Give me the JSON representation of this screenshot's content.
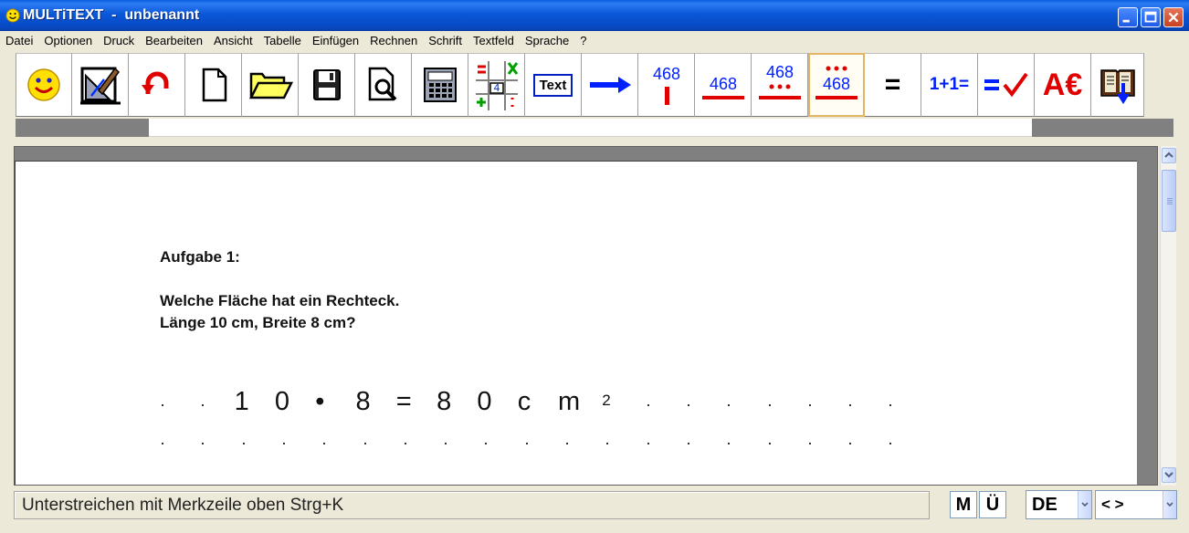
{
  "window": {
    "title": "MULTiTEXT  -  unbenannt"
  },
  "menu": {
    "items": [
      {
        "label": "Datei"
      },
      {
        "label": "Optionen"
      },
      {
        "label": "Druck"
      },
      {
        "label": "Bearbeiten"
      },
      {
        "label": "Ansicht"
      },
      {
        "label": "Tabelle"
      },
      {
        "label": "Einfügen"
      },
      {
        "label": "Rechnen"
      },
      {
        "label": "Schrift"
      },
      {
        "label": "Textfeld"
      },
      {
        "label": "Sprache"
      },
      {
        "label": "?"
      }
    ]
  },
  "toolbar": {
    "text_button_label": "Text",
    "num_label": "468",
    "one_plus_one": "1+1=",
    "equals": "=",
    "euro": "A€",
    "active_tool": "unterstreichen-merkzeile-oben"
  },
  "document": {
    "heading": "Aufgabe 1:",
    "line1": "Welche Fläche hat ein Rechteck.",
    "line2": "Länge 10 cm, Breite 8 cm?",
    "calc_tokens": [
      "1",
      "0",
      "•",
      "8",
      "=",
      "8",
      "0",
      "c",
      "m"
    ],
    "calc_superscript": "2"
  },
  "statusbar": {
    "hint": "Unterstreichen mit Merkzeile oben Strg+K",
    "m_button": "M",
    "ue_button": "Ü",
    "language": "DE",
    "nav": "< >"
  },
  "colors": {
    "accent_red": "#e00000",
    "accent_blue": "#0000ff",
    "active_border": "#e5b460"
  }
}
